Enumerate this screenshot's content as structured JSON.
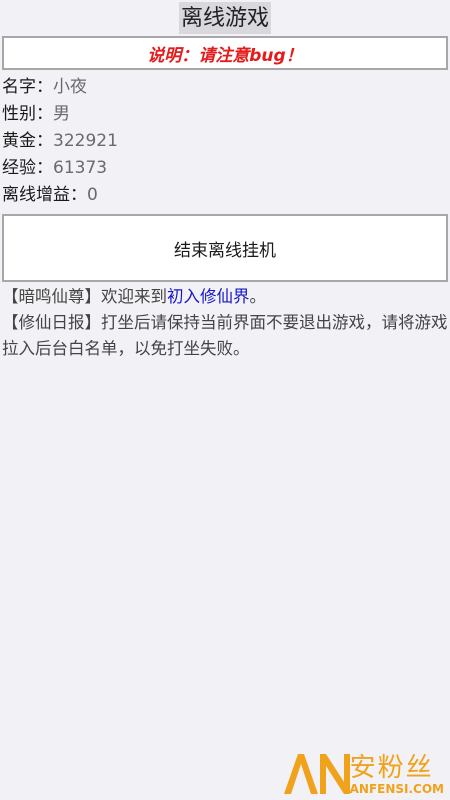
{
  "header": {
    "title": "离线游戏"
  },
  "notice": {
    "text": "说明：请注意bug！"
  },
  "stats": [
    {
      "label": "名字：",
      "value": "小夜"
    },
    {
      "label": "性别：",
      "value": "男"
    },
    {
      "label": "黄金：",
      "value": "322921"
    },
    {
      "label": "经验：",
      "value": "61373"
    },
    {
      "label": "离线增益：",
      "value": "0"
    }
  ],
  "actions": {
    "end_idle_label": "结束离线挂机"
  },
  "log": [
    {
      "prefix": "【暗鸣仙尊】欢迎来到",
      "link": "初入修仙界",
      "suffix": "。"
    },
    {
      "text": "【修仙日报】打坐后请保持当前界面不要退出游戏，请将游戏拉入后台白名单，以免打坐失败。"
    }
  ],
  "watermark": {
    "cn": "安粉丝",
    "en": "ANFENSI.COM"
  },
  "colors": {
    "notice": "#e51b1b",
    "link": "#1616c8",
    "watermark": "#f1a21b"
  }
}
